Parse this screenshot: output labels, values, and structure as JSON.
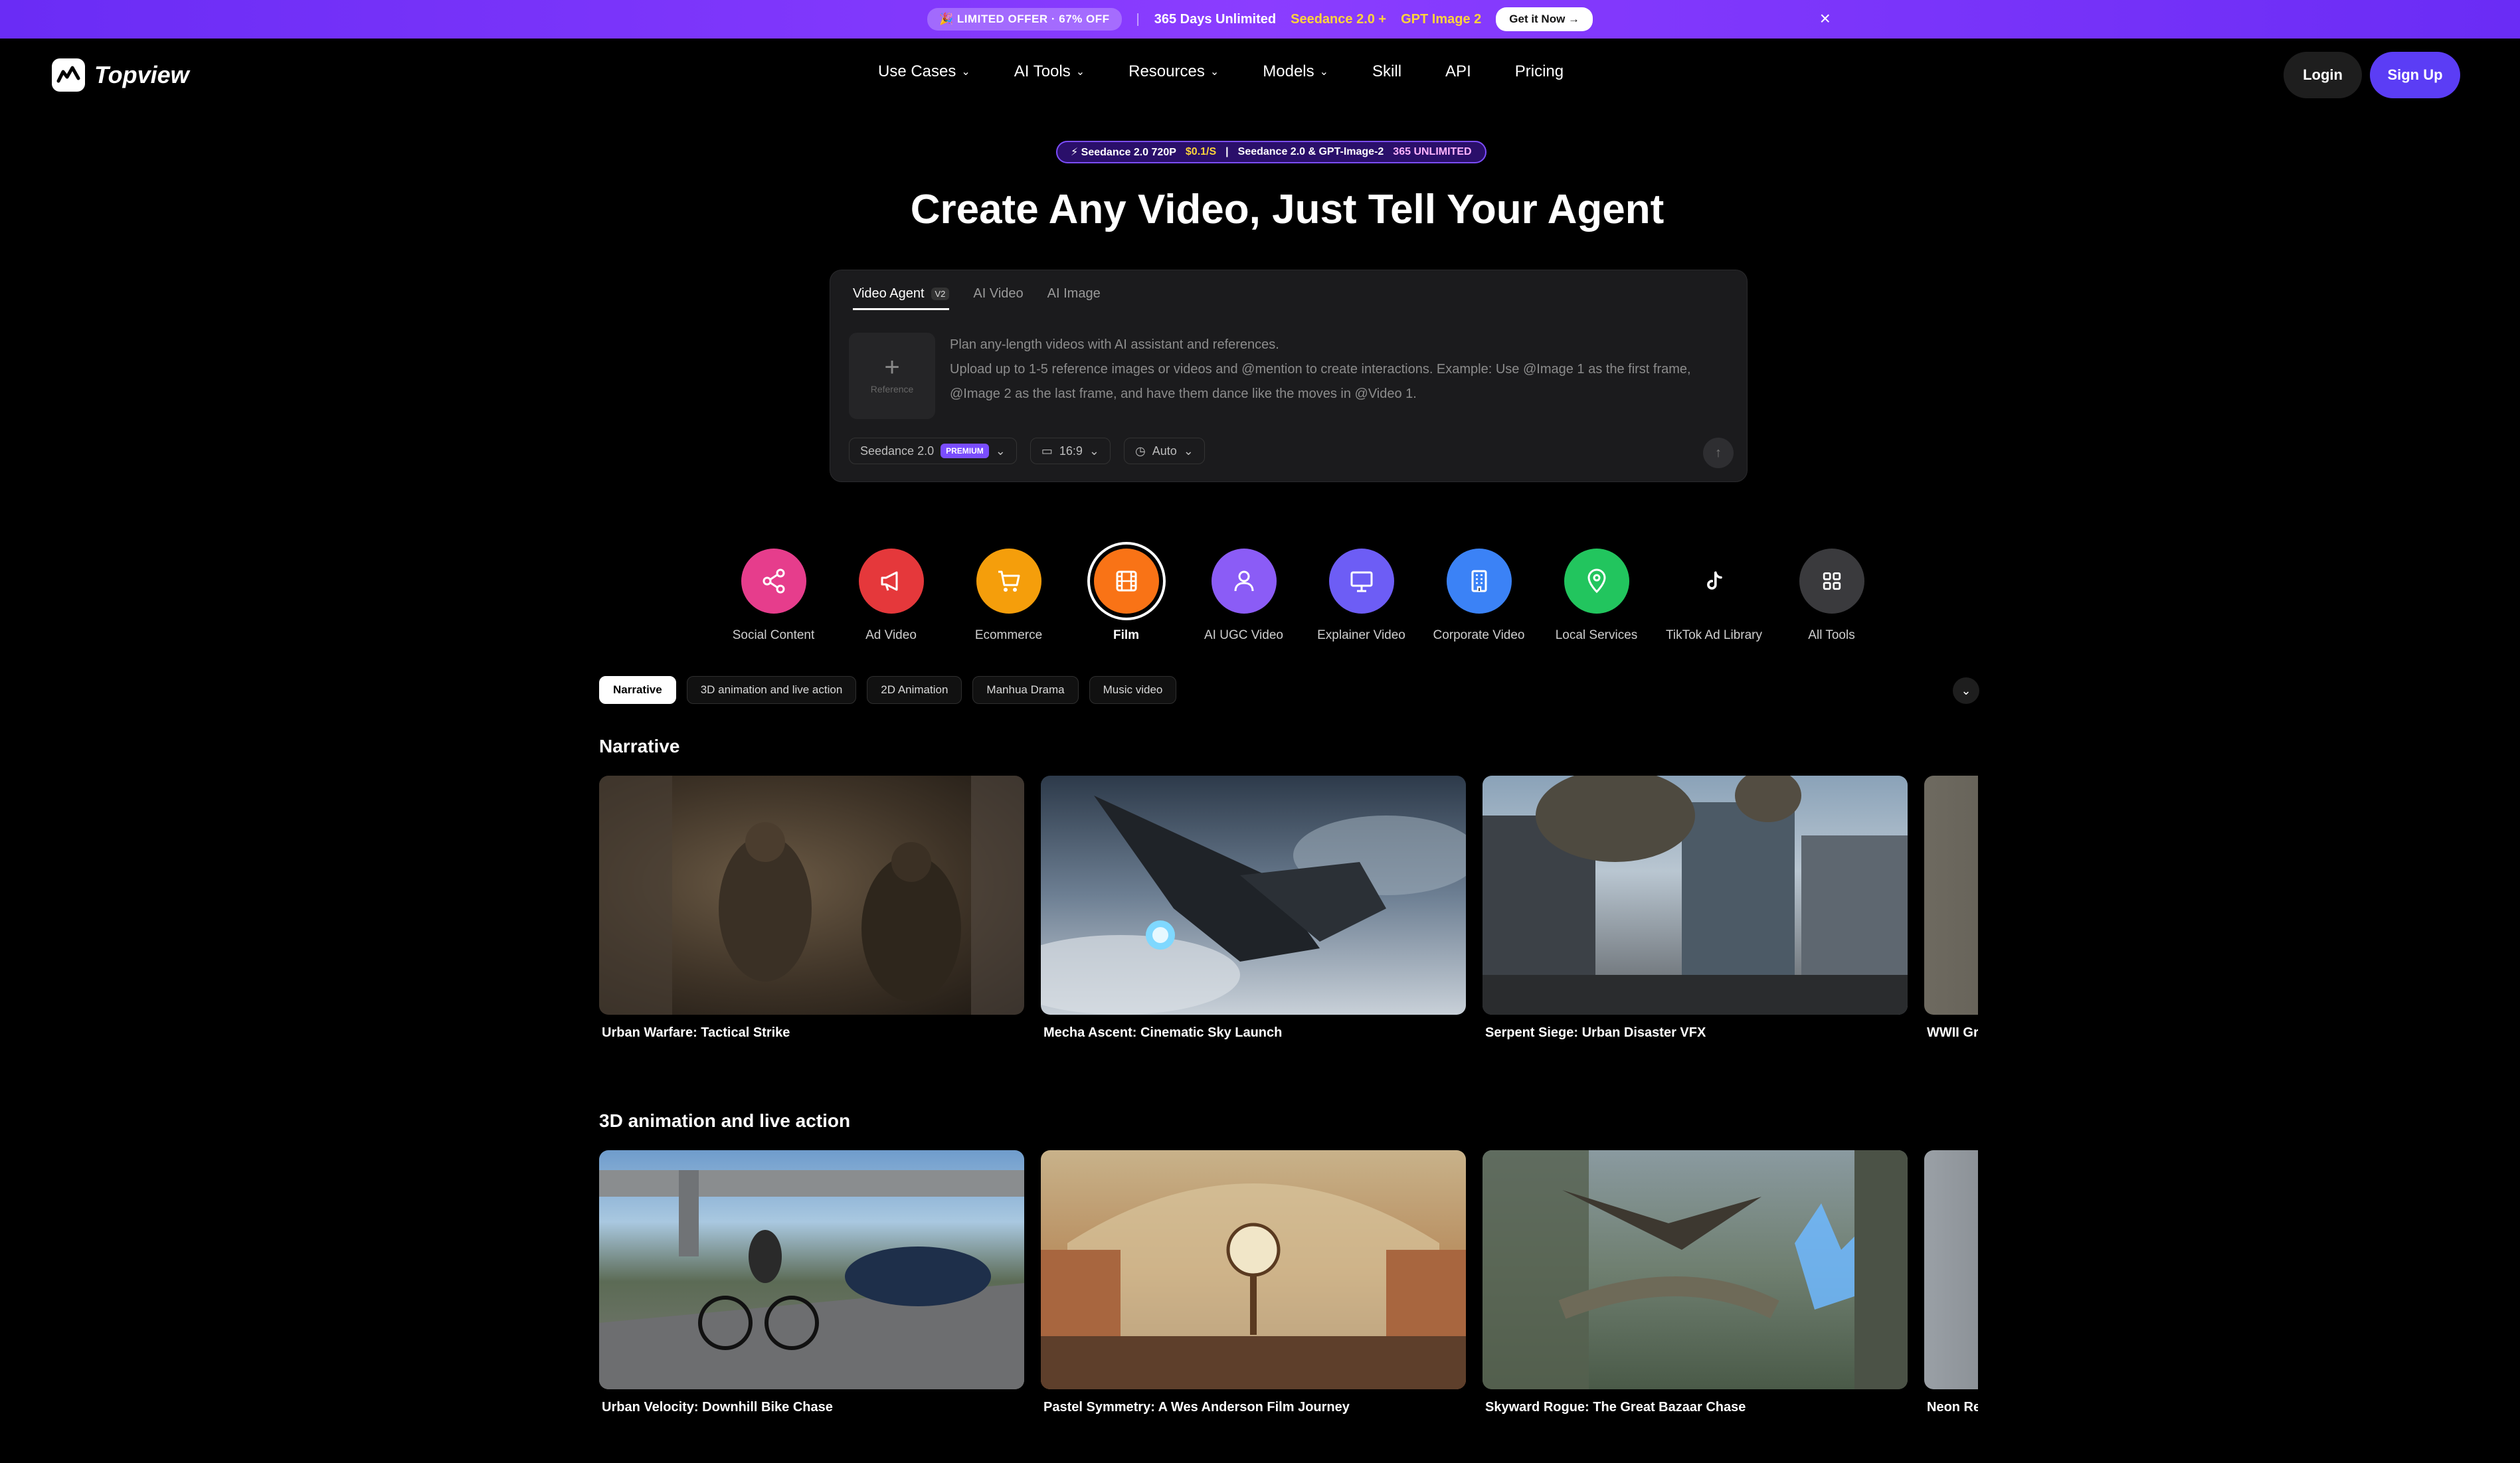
{
  "promo": {
    "offer": "🎉 LIMITED OFFER · 67% OFF",
    "text": "365 Days Unlimited",
    "model1": "Seedance 2.0 +",
    "model2": "GPT Image 2",
    "cta": "Get it Now →",
    "close": "×"
  },
  "header": {
    "brand": "Topview",
    "nav": [
      "Use Cases",
      "AI Tools",
      "Resources",
      "Models",
      "Skill",
      "API",
      "Pricing"
    ],
    "login": "Login",
    "signup": "Sign Up"
  },
  "hero": {
    "badge_a": "⚡ Seedance 2.0 720P",
    "badge_price": "$0.1/S",
    "badge_b": "Seedance 2.0 & GPT-Image-2",
    "badge_c": "365 UNLIMITED",
    "title": "Create Any Video, Just Tell Your Agent"
  },
  "composer": {
    "tabs": [
      "Video Agent",
      "AI Video",
      "AI Image"
    ],
    "version": "V2",
    "reference": "Reference",
    "placeholder_line1": "Plan any-length videos with AI assistant and references.",
    "placeholder_line2": "Upload up to 1-5 reference images or videos and @mention to create interactions. Example: Use @Image 1 as the first frame,",
    "placeholder_line3": "@Image 2 as the last frame, and have them dance like the moves in @Video 1.",
    "model": "Seedance 2.0",
    "model_badge": "PREMIUM",
    "ratio": "16:9",
    "duration": "Auto"
  },
  "categories": [
    {
      "label": "Social Content",
      "color": "#e63d8c",
      "icon": "share-icon"
    },
    {
      "label": "Ad Video",
      "color": "#e5383b",
      "icon": "megaphone-icon"
    },
    {
      "label": "Ecommerce",
      "color": "#f59e0b",
      "icon": "cart-icon"
    },
    {
      "label": "Film",
      "color": "#f97316",
      "icon": "film-icon"
    },
    {
      "label": "AI UGC Video",
      "color": "#8b5cf6",
      "icon": "person-icon"
    },
    {
      "label": "Explainer Video",
      "color": "#6d5df5",
      "icon": "presentation-icon"
    },
    {
      "label": "Corporate Video",
      "color": "#3b82f6",
      "icon": "building-icon"
    },
    {
      "label": "Local Services",
      "color": "#22c55e",
      "icon": "pin-icon"
    },
    {
      "label": "TikTok Ad Library",
      "color": "#000000",
      "icon": "tiktok-icon"
    },
    {
      "label": "All Tools",
      "color": "#3a3a3d",
      "icon": "grid-icon"
    }
  ],
  "chips": [
    "Narrative",
    "3D animation and live action",
    "2D Animation",
    "Manhua Drama",
    "Music video"
  ],
  "sections": [
    {
      "title": "Narrative",
      "cards": [
        "Urban Warfare: Tactical Strike",
        "Mecha Ascent: Cinematic Sky Launch",
        "Serpent Siege: Urban Disaster VFX",
        "WWII Gr"
      ]
    },
    {
      "title": "3D animation and live action",
      "cards": [
        "Urban Velocity: Downhill Bike Chase",
        "Pastel Symmetry: A Wes Anderson Film Journey",
        "Skyward Rogue: The Great Bazaar Chase",
        "Neon Re"
      ]
    }
  ]
}
